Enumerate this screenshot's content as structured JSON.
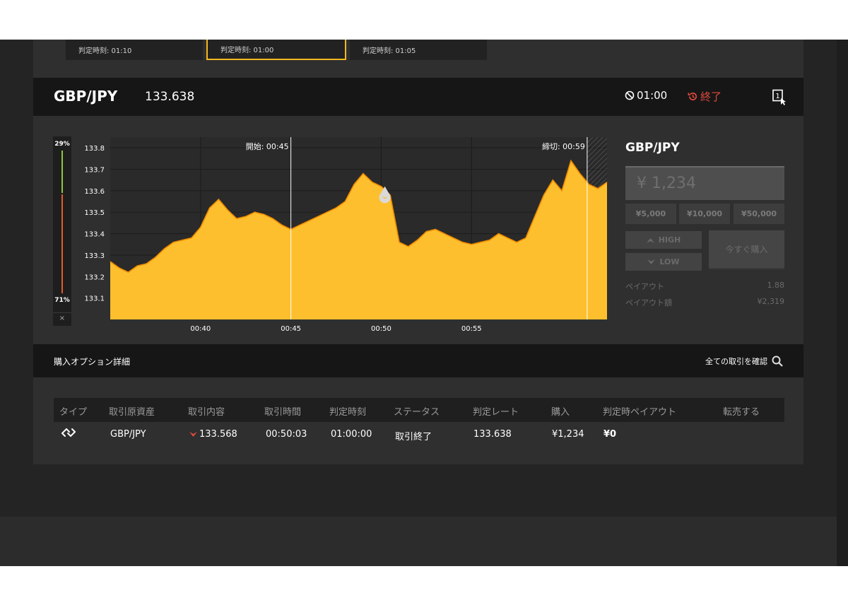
{
  "time_cards": [
    {
      "label": "判定時刻: 01:10",
      "selected": false
    },
    {
      "label": "判定時刻: 01:00",
      "selected": true
    },
    {
      "label": "判定時刻: 01:05",
      "selected": false
    }
  ],
  "asset_header": {
    "pair": "GBP/JPY",
    "price": "133.638",
    "timer": "01:00",
    "status": "終了",
    "mode_icon": "one-click-icon"
  },
  "sentiment": {
    "high_pct": "29%",
    "low_pct": "71%",
    "close_label": "×",
    "colors": {
      "high": "#8ec63f",
      "low": "#e35b2b"
    }
  },
  "chart_data": {
    "type": "area",
    "color": "#fdbf2d",
    "outline_color": "#f08a00",
    "y_ticks": [
      "133.8",
      "133.7",
      "133.6",
      "133.5",
      "133.4",
      "133.3",
      "133.2",
      "133.1"
    ],
    "x_ticks": [
      "00:40",
      "00:45",
      "00:50",
      "00:55"
    ],
    "start_marker": {
      "label": "開始",
      "time": "00:45"
    },
    "end_marker": {
      "label": "締切",
      "time": "00:59"
    },
    "entry_price": 133.568,
    "series": [
      [
        0,
        133.27
      ],
      [
        0.5,
        133.24
      ],
      [
        1,
        133.22
      ],
      [
        1.5,
        133.25
      ],
      [
        2,
        133.26
      ],
      [
        2.5,
        133.29
      ],
      [
        3,
        133.33
      ],
      [
        3.5,
        133.36
      ],
      [
        4,
        133.37
      ],
      [
        4.5,
        133.38
      ],
      [
        5,
        133.43
      ],
      [
        5.5,
        133.52
      ],
      [
        6,
        133.56
      ],
      [
        6.5,
        133.51
      ],
      [
        7,
        133.47
      ],
      [
        7.5,
        133.48
      ],
      [
        8,
        133.5
      ],
      [
        8.5,
        133.49
      ],
      [
        9,
        133.47
      ],
      [
        9.5,
        133.44
      ],
      [
        10,
        133.42
      ],
      [
        10.5,
        133.44
      ],
      [
        11,
        133.46
      ],
      [
        11.5,
        133.48
      ],
      [
        12,
        133.5
      ],
      [
        12.5,
        133.52
      ],
      [
        13,
        133.55
      ],
      [
        13.5,
        133.63
      ],
      [
        14,
        133.68
      ],
      [
        14.5,
        133.64
      ],
      [
        15,
        133.62
      ],
      [
        15.5,
        133.58
      ],
      [
        16,
        133.36
      ],
      [
        16.5,
        133.34
      ],
      [
        17,
        133.37
      ],
      [
        17.5,
        133.41
      ],
      [
        18,
        133.42
      ],
      [
        18.5,
        133.4
      ],
      [
        19,
        133.38
      ],
      [
        19.5,
        133.36
      ],
      [
        20,
        133.35
      ],
      [
        20.5,
        133.36
      ],
      [
        21,
        133.37
      ],
      [
        21.5,
        133.4
      ],
      [
        22,
        133.38
      ],
      [
        22.5,
        133.36
      ],
      [
        23,
        133.38
      ],
      [
        23.5,
        133.48
      ],
      [
        24,
        133.58
      ],
      [
        24.5,
        133.65
      ],
      [
        25,
        133.6
      ],
      [
        25.5,
        133.74
      ],
      [
        26,
        133.68
      ],
      [
        26.5,
        133.63
      ],
      [
        27,
        133.61
      ],
      [
        27.5,
        133.64
      ]
    ],
    "y_min": 133.0,
    "y_max": 133.85,
    "x_max": 27.5
  },
  "trade_panel": {
    "pair": "GBP/JPY",
    "amount": "¥ 1,234",
    "presets": [
      "¥5,000",
      "¥10,000",
      "¥50,000"
    ],
    "high_label": "HIGH",
    "low_label": "LOW",
    "buy_label": "今すぐ購入",
    "payout_label": "ペイアウト",
    "payout_value": "1.88",
    "payout_amount_label": "ペイアウト額",
    "payout_amount_value": "¥2,319"
  },
  "details": {
    "title": "購入オプション詳細",
    "confirm_all": "全ての取引を確認",
    "columns": [
      "タイプ",
      "取引原資産",
      "取引内容",
      "取引時間",
      "判定時刻",
      "ステータス",
      "判定レート",
      "購入",
      "判定時ペイアウト",
      "転売する"
    ],
    "row": {
      "type_icon": "high-low-icon",
      "asset": "GBP/JPY",
      "content": "133.568",
      "trade_time": "00:50:03",
      "judge_time": "01:00:00",
      "status": "取引終了",
      "judge_rate": "133.638",
      "purchase": "¥1,234",
      "payout": "¥0"
    }
  }
}
